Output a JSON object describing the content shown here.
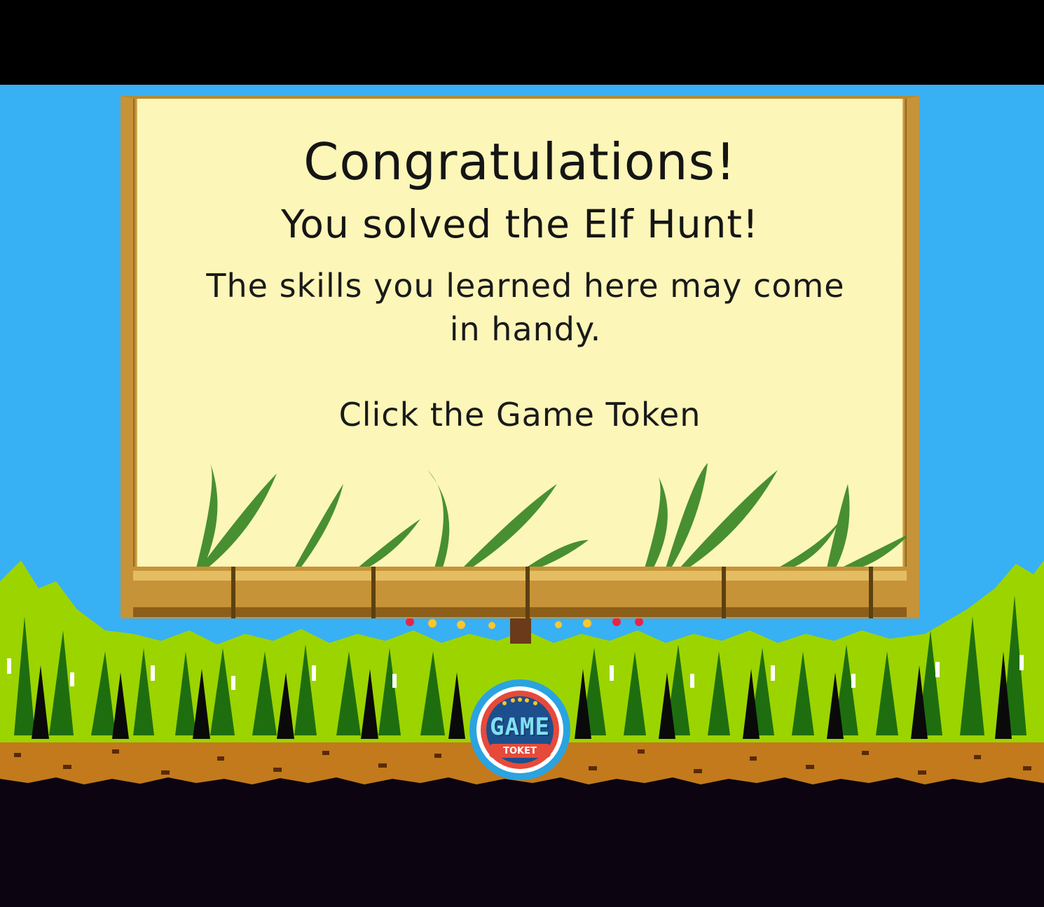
{
  "modal": {
    "title": "Congratulations!",
    "subtitle": "You solved the Elf Hunt!",
    "body": "The skills you learned here may come in handy.",
    "cta": "Click the Game Token"
  },
  "token": {
    "label": "GAME",
    "sublabel": "TOKET",
    "icon": "game-token-icon"
  },
  "colors": {
    "sky": "#38b0f4",
    "grass": "#9cd400",
    "grass_dark": "#1e8a12",
    "dirt": "#c27a1c",
    "ground": "#0c0410",
    "scroll": "#fcf6b8",
    "bamboo": "#c69338",
    "token_ring": "#2aa3e0",
    "token_inner": "#e64a3a"
  }
}
